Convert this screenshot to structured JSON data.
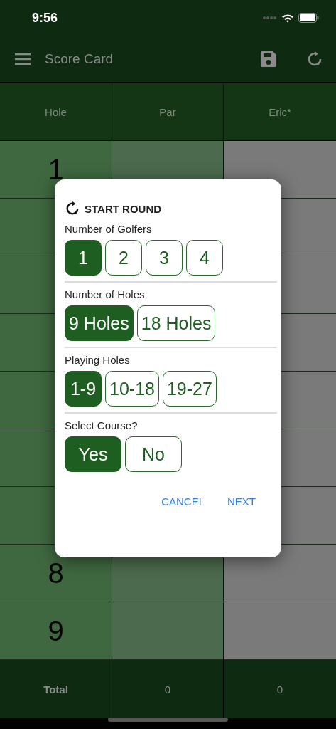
{
  "status_bar": {
    "time": "9:56"
  },
  "app_bar": {
    "title": "Score Card"
  },
  "table": {
    "columns": [
      "Hole",
      "Par",
      "Eric*"
    ],
    "rows": [
      {
        "hole": "1"
      },
      {},
      {},
      {},
      {},
      {},
      {},
      {
        "hole": "8"
      },
      {
        "hole": "9"
      }
    ],
    "totals": [
      "Total",
      "0",
      "0"
    ]
  },
  "dialog": {
    "title": "START ROUND",
    "sections": [
      {
        "label": "Number of Golfers",
        "options": [
          {
            "label": "1",
            "selected": true
          },
          {
            "label": "2",
            "selected": false
          },
          {
            "label": "3",
            "selected": false
          },
          {
            "label": "4",
            "selected": false
          }
        ]
      },
      {
        "label": "Number of Holes",
        "options": [
          {
            "label": "9 Holes",
            "selected": true
          },
          {
            "label": "18 Holes",
            "selected": false
          }
        ]
      },
      {
        "label": "Playing Holes",
        "options": [
          {
            "label": "1-9",
            "selected": true
          },
          {
            "label": "10-18",
            "selected": false
          },
          {
            "label": "19-27",
            "selected": false
          }
        ]
      },
      {
        "label": "Select Course?",
        "options": [
          {
            "label": "Yes",
            "selected": true
          },
          {
            "label": "No",
            "selected": false
          }
        ]
      }
    ],
    "buttons": [
      "CANCEL",
      "NEXT"
    ]
  }
}
